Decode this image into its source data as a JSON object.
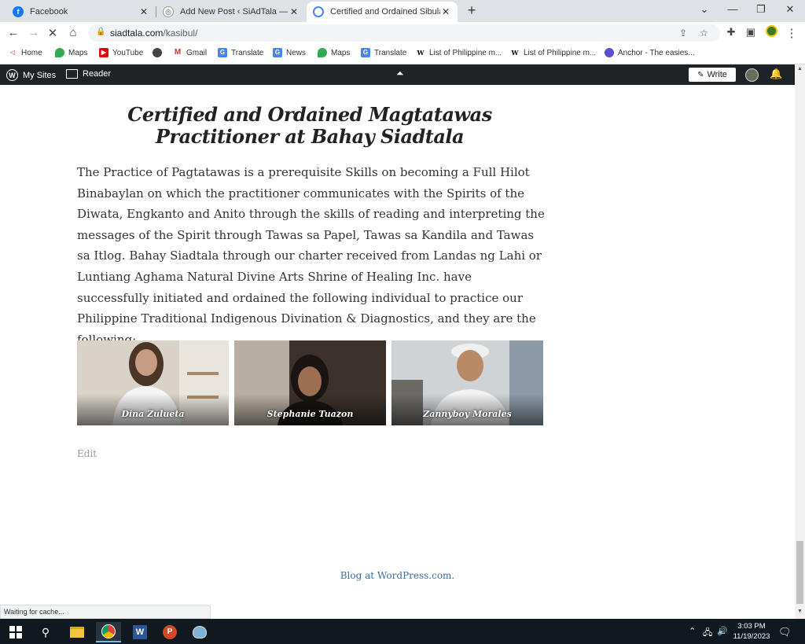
{
  "browser": {
    "tabs": [
      {
        "title": "Facebook",
        "active": false
      },
      {
        "title": "Add New Post ‹ SiAdTala — Word",
        "active": false
      },
      {
        "title": "Certified and Ordained Sibulan A",
        "active": true
      }
    ],
    "url_host": "siadtala.com",
    "url_path": "/kasibul/",
    "bookmarks": [
      "Home",
      "Maps",
      "YouTube",
      "Gmail",
      "Translate",
      "News",
      "Maps",
      "Translate",
      "List of Philippine m...",
      "List of Philippine m...",
      "Anchor - The easies..."
    ]
  },
  "adminbar": {
    "my_sites": "My Sites",
    "reader": "Reader",
    "write": "Write"
  },
  "post": {
    "title": "Certified and Ordained Magtatawas Practitioner at Bahay Siadtala",
    "body": "The Practice of Pagtatawas is a prerequisite Skills on becoming a Full Hilot Binabaylan on which the practitioner communicates with the Spirits of the Diwata, Engkanto and Anito through the skills of reading and interpreting the messages of the Spirit through Tawas sa Papel, Tawas sa Kandila and Tawas sa Itlog. Bahay Siadtala through our charter received from Landas ng Lahi or Luntiang Aghama Natural Divine Arts Shrine of Healing Inc. have successfully initiated and ordained the following individual to practice our Philippine Traditional Indigenous Divination & Diagnostics, and they are the following:",
    "gallery": [
      {
        "caption": "Dina Zulueta"
      },
      {
        "caption": "Stephanie Tuazon"
      },
      {
        "caption": "Zannyboy Morales"
      }
    ],
    "edit": "Edit"
  },
  "footer": {
    "link": "Blog at WordPress.com."
  },
  "status_bar": "Waiting for cache...",
  "taskbar": {
    "time": "3:03 PM",
    "date": "11/19/2023"
  }
}
